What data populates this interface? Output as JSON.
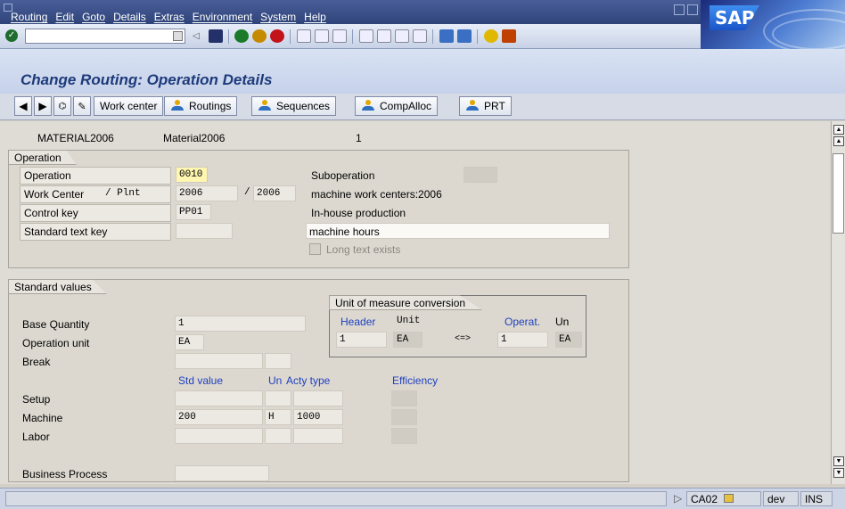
{
  "menubar": {
    "items": [
      "Routing",
      "Edit",
      "Goto",
      "Details",
      "Extras",
      "Environment",
      "System",
      "Help"
    ]
  },
  "title": "Change Routing: Operation Details",
  "app_toolbar": {
    "buttons": [
      "Work center",
      "Routings",
      "Sequences",
      "CompAlloc",
      "PRT"
    ]
  },
  "header": {
    "material": "MATERIAL2006",
    "material_desc": "Material2006",
    "sequence": "1"
  },
  "operation_group": {
    "title": "Operation",
    "operation_label": "Operation",
    "operation_value": "0010",
    "workcenter_label": "Work Center",
    "plant_label": "/ Plnt",
    "workcenter_value": "2006",
    "plant_sep": "/",
    "plant_value": "2006",
    "control_key_label": "Control key",
    "control_key_value": "PP01",
    "std_text_label": "Standard text key",
    "suboperation_label": "Suboperation",
    "workcenter_desc": "machine work centers:2006",
    "control_key_desc": "In-house production",
    "short_text": "machine hours",
    "long_text_label": "Long text exists"
  },
  "standard_values": {
    "title": "Standard values",
    "base_qty_label": "Base Quantity",
    "base_qty_value": "1",
    "op_unit_label": "Operation unit",
    "op_unit_value": "EA",
    "break_label": "Break",
    "col_std_value": "Std value",
    "col_un": "Un",
    "col_acty_type": "Acty type",
    "col_efficiency": "Efficiency",
    "rows": [
      {
        "label": "Setup",
        "value": "",
        "unit": "",
        "acty": ""
      },
      {
        "label": "Machine",
        "value": "200",
        "unit": "H",
        "acty": "1000"
      },
      {
        "label": "Labor",
        "value": "",
        "unit": "",
        "acty": ""
      }
    ],
    "business_process_label": "Business Process",
    "uom_conversion": {
      "title": "Unit of measure conversion",
      "header_label": "Header",
      "unit_label": "Unit",
      "operat_label": "Operat.",
      "un_label": "Un",
      "header_value": "1",
      "header_unit": "EA",
      "arrow": "<=>",
      "operat_value": "1",
      "operat_unit": "EA"
    }
  },
  "statusbar": {
    "transaction": "CA02",
    "system": "dev",
    "mode": "INS"
  },
  "colors": {
    "menubar": "#2f4478",
    "title": "#1d3a7a",
    "highlight_field": "#fff6b0",
    "blue_labels": "#1f3fc0"
  }
}
